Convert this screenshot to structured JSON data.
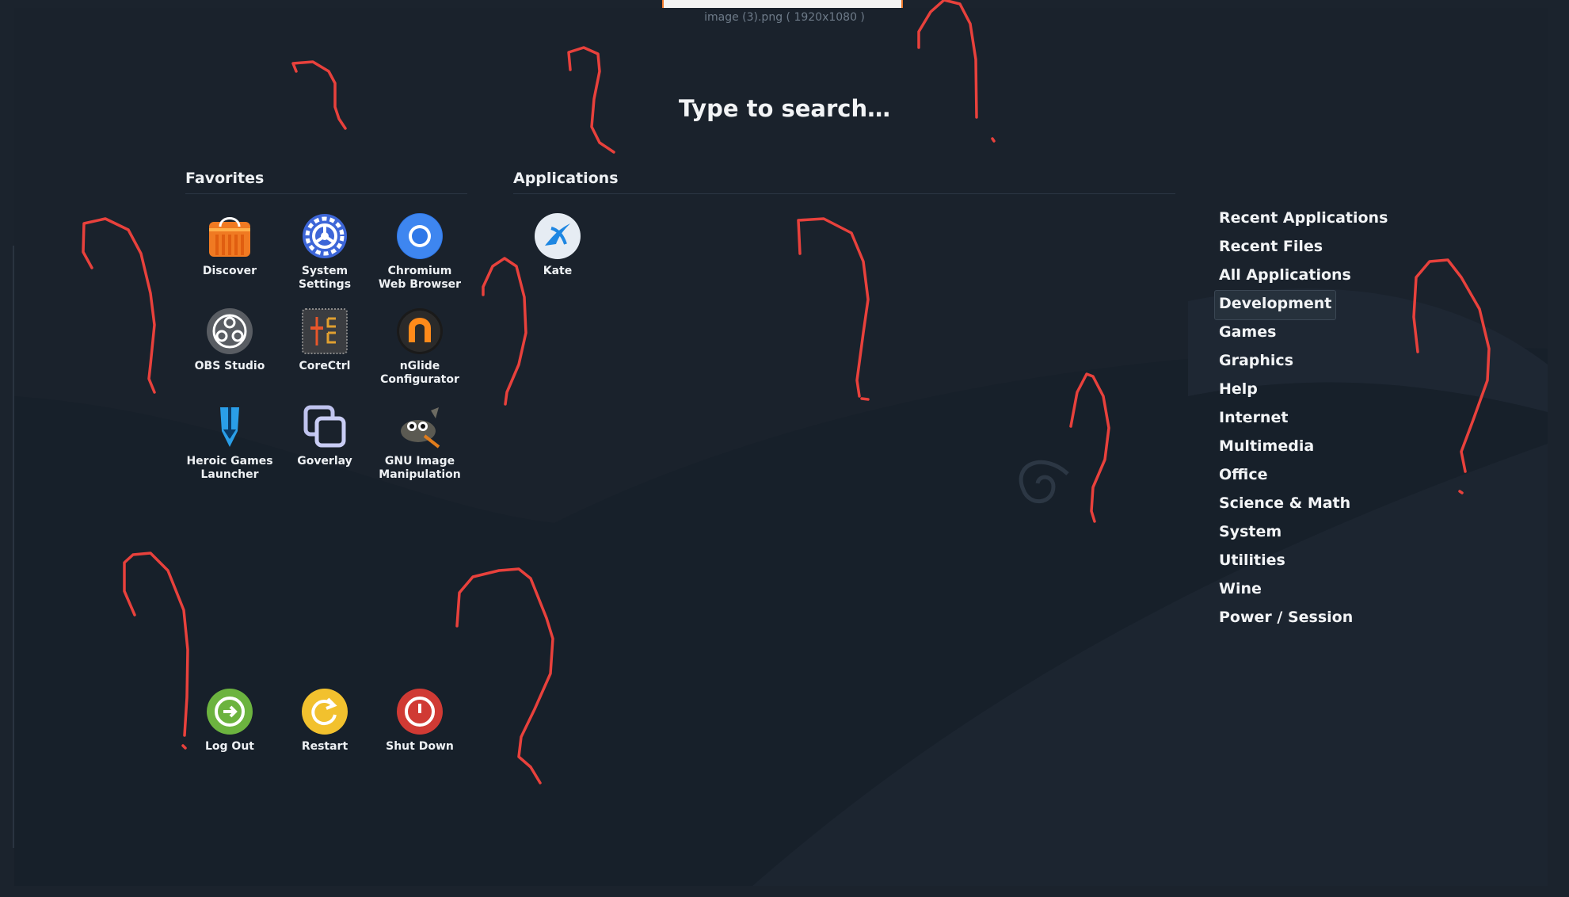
{
  "window": {
    "image_caption": "image (3).png ( 1920x1080 )"
  },
  "search": {
    "prompt": "Type to search…"
  },
  "favorites": {
    "title": "Favorites",
    "apps": [
      {
        "name": "Discover",
        "icon": "discover-icon"
      },
      {
        "name": "System Settings",
        "icon": "system-settings-icon"
      },
      {
        "name": "Chromium Web Browser",
        "icon": "chromium-icon"
      },
      {
        "name": "OBS Studio",
        "icon": "obs-icon"
      },
      {
        "name": "CoreCtrl",
        "icon": "corectrl-icon"
      },
      {
        "name": "nGlide Configurator",
        "icon": "nglide-icon"
      },
      {
        "name": "Heroic Games Launcher",
        "icon": "heroic-icon"
      },
      {
        "name": "Goverlay",
        "icon": "goverlay-icon"
      },
      {
        "name": "GNU Image Manipulation",
        "icon": "gimp-icon"
      }
    ]
  },
  "applications": {
    "title": "Applications",
    "apps": [
      {
        "name": "Kate",
        "icon": "kate-icon"
      }
    ]
  },
  "session": [
    {
      "name": "Log Out",
      "icon": "log-out-icon",
      "color": "#6cb33f"
    },
    {
      "name": "Restart",
      "icon": "restart-icon",
      "color": "#f2c12e"
    },
    {
      "name": "Shut Down",
      "icon": "shut-down-icon",
      "color": "#d03a34"
    }
  ],
  "categories": [
    {
      "label": "Recent Applications"
    },
    {
      "label": "Recent Files"
    },
    {
      "label": "All Applications"
    },
    {
      "label": "Development",
      "active": true
    },
    {
      "label": "Games"
    },
    {
      "label": "Graphics"
    },
    {
      "label": "Help"
    },
    {
      "label": "Internet"
    },
    {
      "label": "Multimedia"
    },
    {
      "label": "Office"
    },
    {
      "label": "Science & Math"
    },
    {
      "label": "System"
    },
    {
      "label": "Utilities"
    },
    {
      "label": "Wine"
    },
    {
      "label": "Power / Session"
    }
  ],
  "colors": {
    "background": "#1a222c",
    "annotation": "#e8413c",
    "active_category": "#26313c"
  }
}
